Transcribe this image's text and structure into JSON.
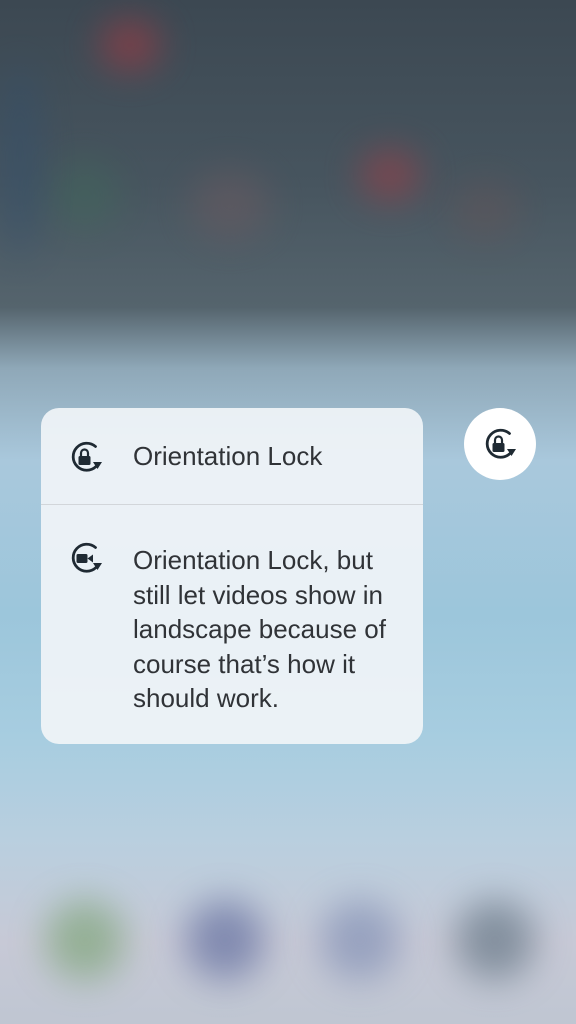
{
  "menu": {
    "items": [
      {
        "label": "Orientation Lock",
        "icon": "orientation-lock-icon"
      },
      {
        "label": "Orientation Lock, but still let videos show in landscape because of course that’s how it should work.",
        "icon": "orientation-lock-video-icon"
      }
    ]
  },
  "control": {
    "icon": "orientation-lock-icon"
  },
  "colors": {
    "menu_background": "#f0f4f7",
    "text": "#303337",
    "icon": "#1f2a33",
    "button_background": "#ffffff"
  }
}
